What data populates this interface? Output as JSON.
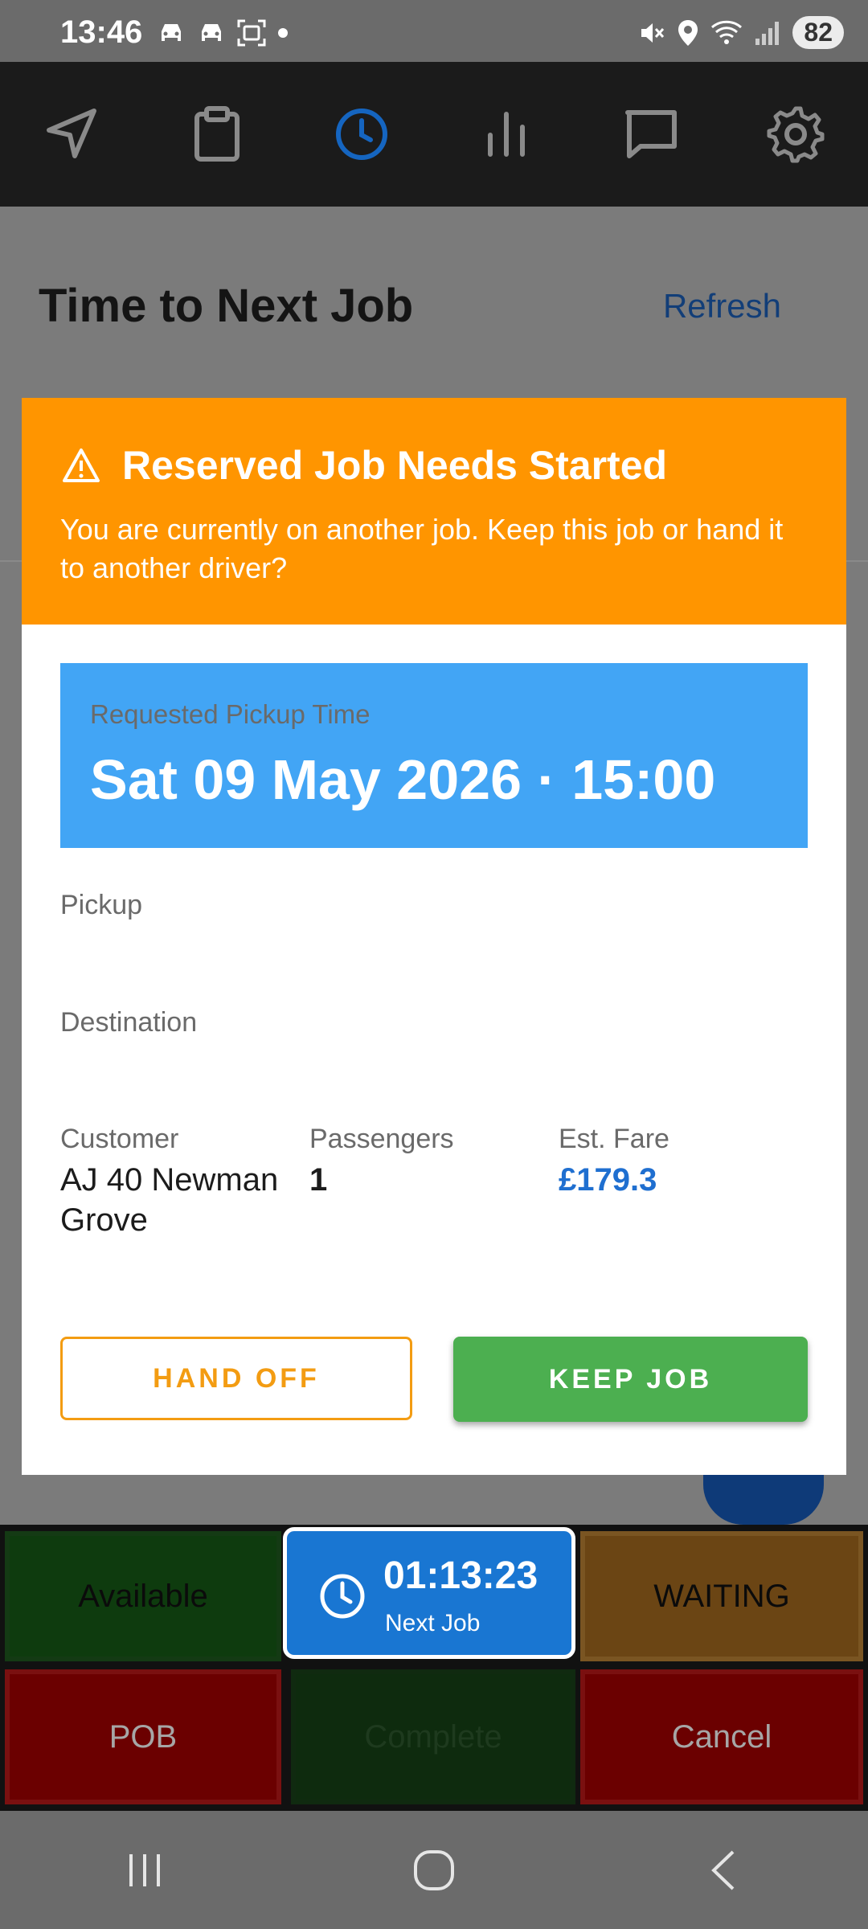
{
  "status_bar": {
    "time": "13:46",
    "left_icons": [
      "car-icon",
      "car-icon",
      "screenshot-icon",
      "dot-icon"
    ],
    "right_icons": [
      "mute-icon",
      "location-icon",
      "wifi-icon",
      "signal-icon"
    ],
    "battery": "82"
  },
  "top_nav": {
    "items": [
      {
        "icon": "navigation-icon",
        "active": false
      },
      {
        "icon": "clipboard-icon",
        "active": false
      },
      {
        "icon": "clock-icon",
        "active": true
      },
      {
        "icon": "bar-chart-icon",
        "active": false
      },
      {
        "icon": "message-icon",
        "active": false
      },
      {
        "icon": "settings-icon",
        "active": false
      }
    ],
    "active_color": "#1565c0"
  },
  "page": {
    "title": "Time to Next Job",
    "refresh_label": "Refresh"
  },
  "modal": {
    "title": "Reserved Job Needs Started",
    "message": "You are currently on another job. Keep this job or hand it to another driver?",
    "pickup_time_label": "Requested Pickup Time",
    "pickup_time_value": "Sat 09 May 2026 · 15:00",
    "pickup_label": "Pickup",
    "destination_label": "Destination",
    "customer_label": "Customer",
    "customer_value": "AJ 40 Newman Grove",
    "passengers_label": "Passengers",
    "passengers_value": "1",
    "fare_label": "Est. Fare",
    "fare_value": "£179.3",
    "hand_off_label": "HAND OFF",
    "keep_job_label": "KEEP JOB",
    "header_color": "#ff9500",
    "pickup_box_color": "#42a5f5"
  },
  "controls": {
    "available_label": "Available",
    "next_job_time": "01:13:23",
    "next_job_label": "Next Job",
    "waiting_label": "WAITING",
    "pob_label": "POB",
    "complete_label": "Complete",
    "cancel_label": "Cancel"
  },
  "system_nav": [
    "recent-apps-icon",
    "home-icon",
    "back-icon"
  ]
}
